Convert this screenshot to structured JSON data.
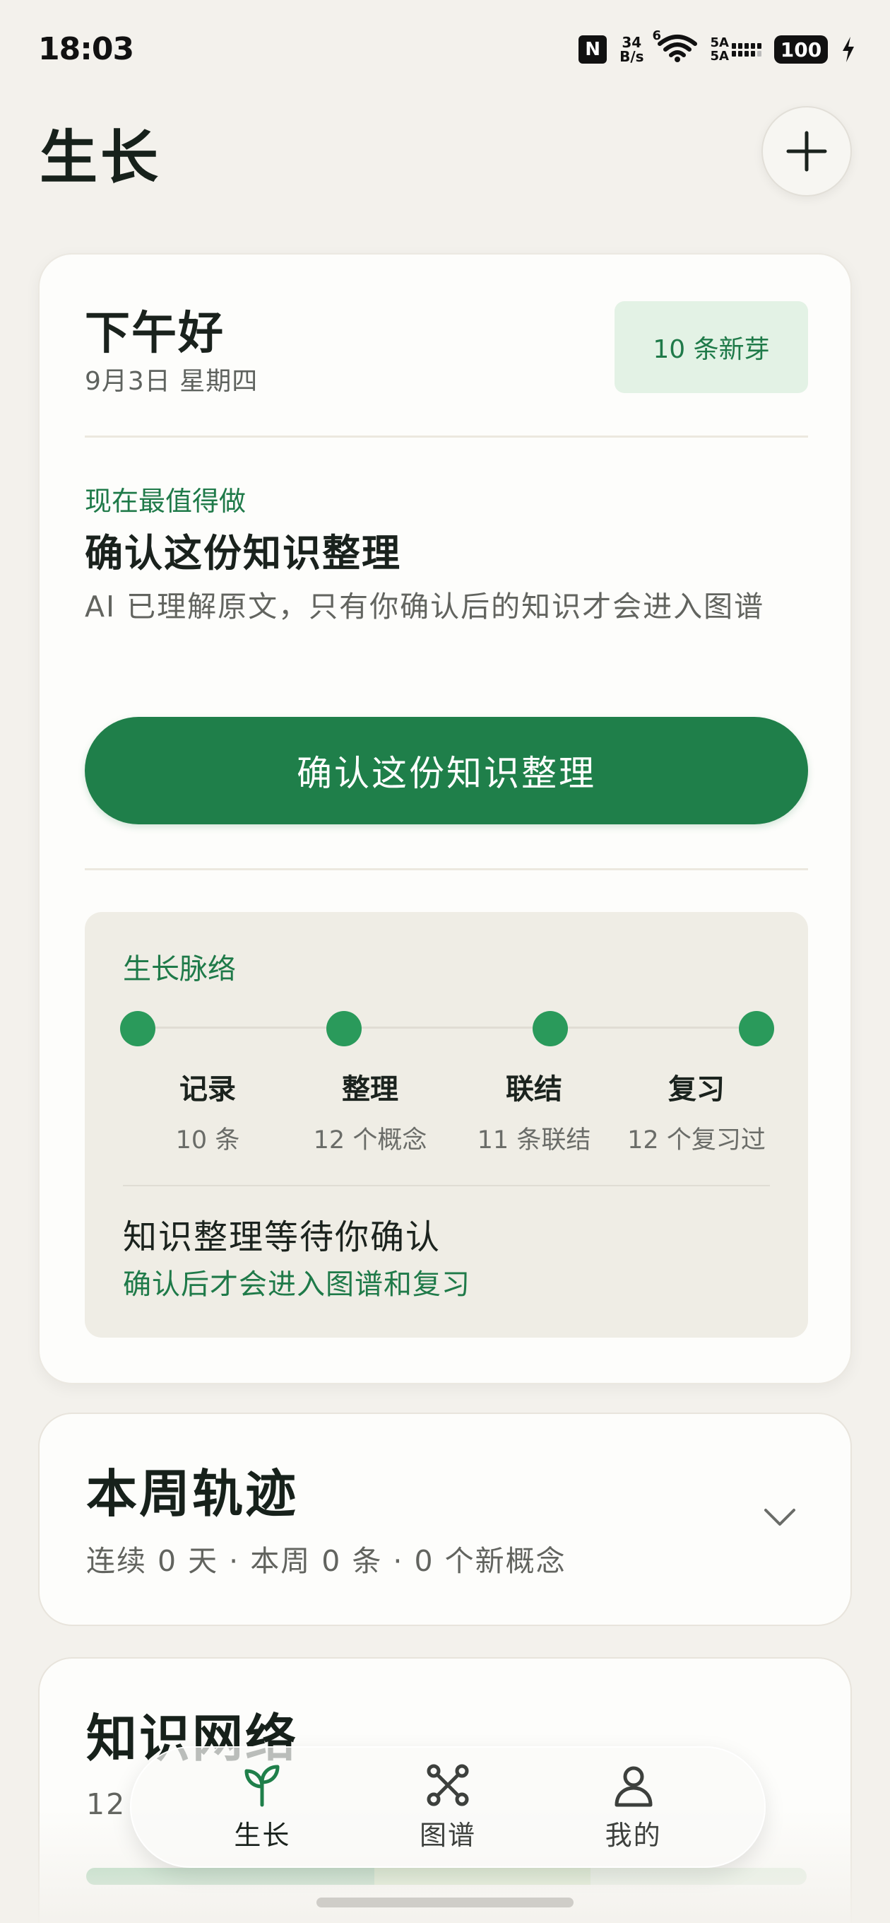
{
  "status_bar": {
    "time": "18:03",
    "nfc": "N",
    "net_speed_value": "34",
    "net_speed_unit": "B/s",
    "wifi_badge": "6",
    "signal_label_1": "5A",
    "signal_label_2": "5A",
    "battery": "100"
  },
  "header": {
    "title": "生长",
    "add_icon": "plus-icon"
  },
  "greeting_card": {
    "greeting": "下午好",
    "date": "9月3日 星期四",
    "sprout_badge": "10 条新芽",
    "action_eyebrow": "现在最值得做",
    "action_title": "确认这份知识整理",
    "action_description": "AI 已理解原文，只有你确认后的知识才会进入图谱",
    "confirm_button": "确认这份知识整理",
    "growth": {
      "title": "生长脉络",
      "stages": [
        {
          "label": "记录",
          "count": "10 条"
        },
        {
          "label": "整理",
          "count": "12 个概念"
        },
        {
          "label": "联结",
          "count": "11 条联结"
        },
        {
          "label": "复习",
          "count": "12 个复习过"
        }
      ],
      "pending_title": "知识整理等待你确认",
      "pending_subtitle": "确认后才会进入图谱和复习"
    }
  },
  "week_card": {
    "title": "本周轨迹",
    "stats": "连续 0 天 · 本周 0 条 · 0 个新概念"
  },
  "network_card": {
    "title": "知识网络",
    "stats_prefix": "12"
  },
  "tab_bar": {
    "tabs": [
      {
        "label": "生长",
        "icon": "sprout-icon",
        "active": true
      },
      {
        "label": "图谱",
        "icon": "graph-icon",
        "active": false
      },
      {
        "label": "我的",
        "icon": "person-icon",
        "active": false
      }
    ]
  },
  "colors": {
    "accent": "#1f7f4a",
    "background": "#f3f1ec",
    "card": "#fdfdfb",
    "badge_bg": "#e3f2e5",
    "panel_bg": "#efede5"
  }
}
